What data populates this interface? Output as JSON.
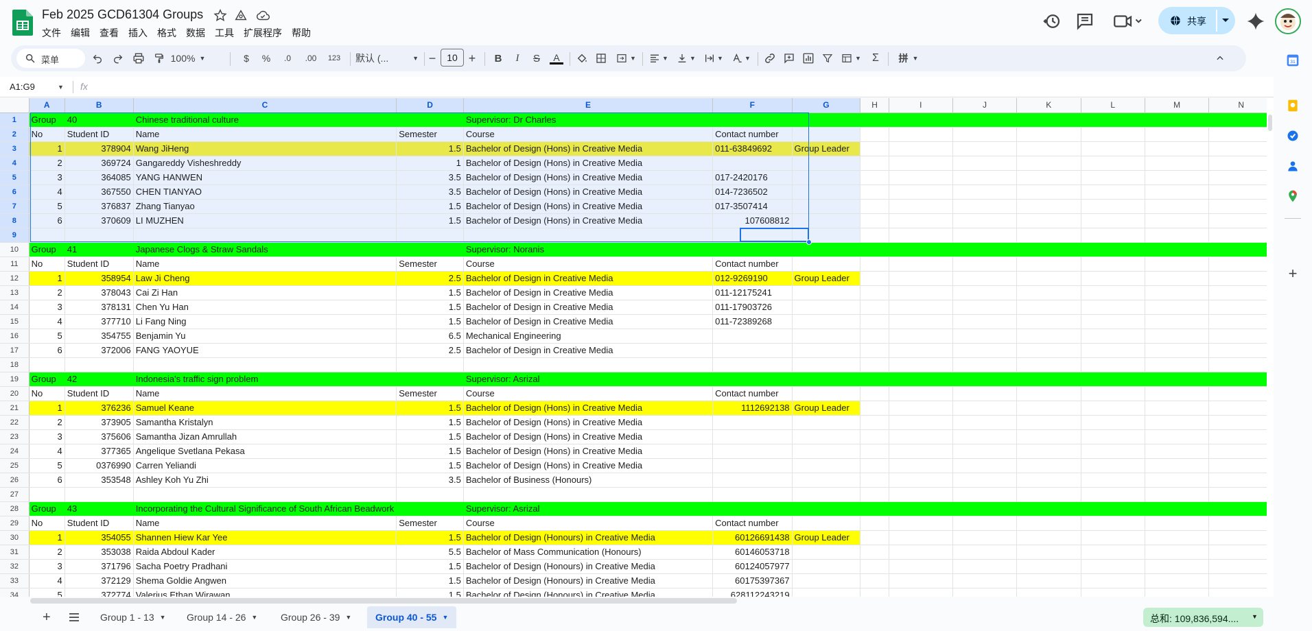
{
  "app": {
    "title": "Feb 2025 GCD61304 Groups",
    "menu": [
      "文件",
      "编辑",
      "查看",
      "插入",
      "格式",
      "数据",
      "工具",
      "扩展程序",
      "帮助"
    ],
    "share_label": "共享"
  },
  "toolbar": {
    "search_label": "菜单",
    "zoom": "100%",
    "currency": "$",
    "percent": "%",
    "dec_decrease": ".0",
    "dec_increase": ".00",
    "number_format": "123",
    "font": "默认 (...",
    "font_size": "10"
  },
  "formula": {
    "name_box": "A1:G9",
    "fx": "fx"
  },
  "columns": [
    "A",
    "B",
    "C",
    "D",
    "E",
    "F",
    "G",
    "H",
    "I",
    "J",
    "K",
    "L",
    "M",
    "N"
  ],
  "rows": [
    {
      "n": "1",
      "type": "group",
      "cells": [
        "Group",
        "40",
        "Chinese traditional culture",
        "",
        "Supervisor: Dr Charles",
        "",
        ""
      ]
    },
    {
      "n": "2",
      "type": "header",
      "cells": [
        "No",
        "Student ID",
        "Name",
        "Semester",
        "Course",
        "Contact number",
        ""
      ]
    },
    {
      "n": "3",
      "type": "leader",
      "cells": [
        "1",
        "378904",
        "Wang JiHeng",
        "1.5",
        "Bachelor of Design (Hons) in Creative Media",
        "011-63849692",
        "Group Leader"
      ]
    },
    {
      "n": "4",
      "type": "data",
      "cells": [
        "2",
        "369724",
        "Gangareddy Visheshreddy",
        "1",
        "Bachelor of Design (Hons) in Creative Media",
        "",
        ""
      ]
    },
    {
      "n": "5",
      "type": "data",
      "cells": [
        "3",
        "364085",
        "YANG HANWEN",
        "3.5",
        "Bachelor of Design (Hons) in Creative Media",
        "017-2420176",
        ""
      ]
    },
    {
      "n": "6",
      "type": "data",
      "cells": [
        "4",
        "367550",
        "CHEN TIANYAO",
        "3.5",
        "Bachelor of Design (Hons) in Creative Media",
        "014-7236502",
        ""
      ]
    },
    {
      "n": "7",
      "type": "data",
      "cells": [
        "5",
        "376837",
        "Zhang Tianyao",
        "1.5",
        "Bachelor of Design (Hons) in Creative Media",
        "017-3507414",
        ""
      ]
    },
    {
      "n": "8",
      "type": "data",
      "cells": [
        "6",
        "370609",
        "LI MUZHEN",
        "1.5",
        "Bachelor of Design (Hons) in Creative Media",
        "107608812",
        ""
      ]
    },
    {
      "n": "9",
      "type": "blank",
      "cells": [
        "",
        "",
        "",
        "",
        "",
        "",
        ""
      ]
    },
    {
      "n": "10",
      "type": "group",
      "cells": [
        "Group",
        "41",
        "Japanese Clogs & Straw Sandals",
        "",
        "Supervisor: Noranis",
        "",
        ""
      ]
    },
    {
      "n": "11",
      "type": "header",
      "cells": [
        "No",
        "Student ID",
        "Name",
        "Semester",
        "Course",
        "Contact number",
        ""
      ]
    },
    {
      "n": "12",
      "type": "leader",
      "cells": [
        "1",
        "358954",
        "Law Ji Cheng",
        "2.5",
        "Bachelor of Design in Creative Media",
        "012-9269190",
        "Group Leader"
      ]
    },
    {
      "n": "13",
      "type": "data",
      "cells": [
        "2",
        "378043",
        "Cai Zi Han",
        "1.5",
        "Bachelor of Design in Creative Media",
        "011-12175241",
        ""
      ]
    },
    {
      "n": "14",
      "type": "data",
      "cells": [
        "3",
        "378131",
        "Chen Yu Han",
        "1.5",
        "Bachelor of Design in Creative Media",
        "011-17903726",
        ""
      ]
    },
    {
      "n": "15",
      "type": "data",
      "cells": [
        "4",
        "377710",
        "Li Fang Ning",
        "1.5",
        "Bachelor of Design in Creative Media",
        "011-72389268",
        ""
      ]
    },
    {
      "n": "16",
      "type": "data",
      "cells": [
        "5",
        "354755",
        "Benjamin Yu",
        "6.5",
        "Mechanical Engineering",
        "",
        ""
      ]
    },
    {
      "n": "17",
      "type": "data",
      "cells": [
        "6",
        "372006",
        "FANG YAOYUE",
        "2.5",
        "Bachelor of Design in Creative Media",
        "",
        ""
      ]
    },
    {
      "n": "18",
      "type": "blank",
      "cells": [
        "",
        "",
        "",
        "",
        "",
        "",
        ""
      ]
    },
    {
      "n": "19",
      "type": "group",
      "cells": [
        "Group",
        "42",
        "Indonesia's traffic sign problem",
        "",
        "Supervisor: Asrizal",
        "",
        ""
      ]
    },
    {
      "n": "20",
      "type": "header",
      "cells": [
        "No",
        "Student ID",
        "Name",
        "Semester",
        "Course",
        "Contact number",
        ""
      ]
    },
    {
      "n": "21",
      "type": "leader",
      "cells": [
        "1",
        "376236",
        "Samuel Keane",
        "1.5",
        "Bachelor of Design (Hons) in Creative Media",
        "1112692138",
        "Group Leader"
      ]
    },
    {
      "n": "22",
      "type": "data",
      "cells": [
        "2",
        "373905",
        "Samantha Kristalyn",
        "1.5",
        "Bachelor of Design (Hons) in Creative Media",
        "",
        ""
      ]
    },
    {
      "n": "23",
      "type": "data",
      "cells": [
        "3",
        "375606",
        "Samantha Jizan Amrullah",
        "1.5",
        "Bachelor of Design (Hons) in Creative Media",
        "",
        ""
      ]
    },
    {
      "n": "24",
      "type": "data",
      "cells": [
        "4",
        "377365",
        "Angelique Svetlana Pekasa",
        "1.5",
        "Bachelor of Design (Hons) in Creative Media",
        "",
        ""
      ]
    },
    {
      "n": "25",
      "type": "data",
      "cells": [
        "5",
        "0376990",
        "Carren Yeliandi",
        "1.5",
        "Bachelor of Design (Hons) in Creative Media",
        "",
        ""
      ]
    },
    {
      "n": "26",
      "type": "data",
      "cells": [
        "6",
        "353548",
        "Ashley Koh Yu Zhi",
        "3.5",
        "Bachelor of Business (Honours)",
        "",
        ""
      ]
    },
    {
      "n": "27",
      "type": "blank",
      "cells": [
        "",
        "",
        "",
        "",
        "",
        "",
        ""
      ]
    },
    {
      "n": "28",
      "type": "group",
      "cells": [
        "Group",
        "43",
        "Incorporating the Cultural Significance of South African Beadwork",
        "",
        "Supervisor: Asrizal",
        "",
        ""
      ]
    },
    {
      "n": "29",
      "type": "header",
      "cells": [
        "No",
        "Student ID",
        "Name",
        "Semester",
        "Course",
        "Contact number",
        ""
      ]
    },
    {
      "n": "30",
      "type": "leader",
      "cells": [
        "1",
        "354055",
        "Shannen Hiew Kar Yee",
        "1.5",
        "Bachelor of Design (Honours) in Creative Media",
        "60126691438",
        "Group Leader"
      ]
    },
    {
      "n": "31",
      "type": "data",
      "cells": [
        "2",
        "353038",
        "Raida Abdoul Kader",
        "5.5",
        "Bachelor of Mass Communication  (Honours)",
        "60146053718",
        ""
      ]
    },
    {
      "n": "32",
      "type": "data",
      "cells": [
        "3",
        "371796",
        "Sacha Poetry Pradhani",
        "1.5",
        "Bachelor of Design (Honours) in Creative Media",
        "60124057977",
        ""
      ]
    },
    {
      "n": "33",
      "type": "data",
      "cells": [
        "4",
        "372129",
        "Shema Goldie Angwen",
        "1.5",
        "Bachelor of Design (Honours) in Creative Media",
        "60175397367",
        ""
      ]
    },
    {
      "n": "34",
      "type": "data",
      "cells": [
        "5",
        "372774",
        "Valerius Ethan Wirawan",
        "1.5",
        "Bachelor of Design (Honours) in Creative Media",
        "628112243219",
        ""
      ]
    }
  ],
  "sheets": [
    "Group 1 - 13",
    "Group 14 - 26",
    "Group 26 - 39",
    "Group 40 - 55"
  ],
  "active_sheet": "Group 40 - 55",
  "sum_label": "总和: 109,836,594....",
  "colors": {
    "group_row": "#00ff00",
    "leader_row": "#ffff00",
    "selection": "#1a73e8",
    "share": "#c2e7ff"
  }
}
